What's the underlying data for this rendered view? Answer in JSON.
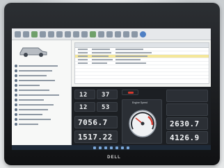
{
  "dashboard": {
    "gauge_title": "Engine Speed",
    "readout_left_1": "12",
    "readout_right_1": "37",
    "readout_left_2": "12",
    "readout_right_2": "53",
    "readout_big_1": "7056.7",
    "readout_big_2": "1517.22",
    "readout_right_big_1": "2630.7",
    "readout_right_big_2": "4126.9"
  },
  "brand": {
    "logo_text": "DELL"
  },
  "colors": {
    "screen_bg": "#f3f4f2",
    "dash_bg": "#1c1f23",
    "selected_row": "#f4e79a",
    "accent_red": "#d83a2e"
  },
  "icons": [
    "car-icon",
    "speedometer-icon",
    "warning-icon",
    "windows-start-icon"
  ]
}
